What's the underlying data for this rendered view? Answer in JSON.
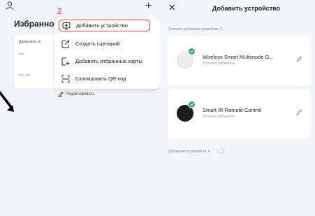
{
  "left_panel": {
    "favorites_title": "Избранное",
    "card": {
      "label": "Домашнее эн",
      "value_1": "--",
      "value_2": "-- --"
    },
    "step_number": "2",
    "menu": {
      "items": [
        {
          "label": "Добавить устройство",
          "icon": "add-device-icon"
        },
        {
          "label": "Создать сценарий",
          "icon": "create-scene-icon"
        },
        {
          "label": "Добавить избранные карты",
          "icon": "add-favorite-card-icon"
        },
        {
          "label": "Сканировать QR-код",
          "icon": "scan-qr-icon"
        }
      ]
    },
    "edit_label": "Редактировать",
    "highlight_color": "#d9403a"
  },
  "right_panel": {
    "title": "Добавить устройство",
    "success_label": "Успешно добавлено устройств: 2",
    "devices": [
      {
        "name": "Wireless Smart Multimode G...",
        "status": "Успешно добавлено",
        "color": "#ececec"
      },
      {
        "name": "Smart IR Remote Control",
        "status": "Успешно добавлено",
        "color": "#1e1e1e"
      }
    ],
    "adding_label": "Добавляется устройств: 0",
    "success_color": "#2db37a"
  }
}
